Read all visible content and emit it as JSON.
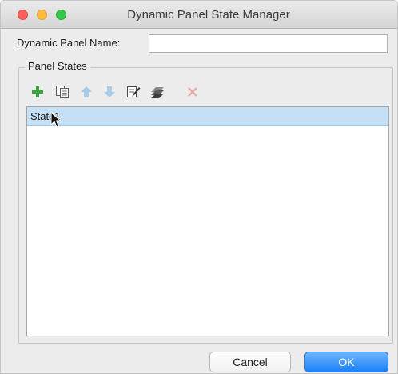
{
  "window": {
    "title": "Dynamic Panel State Manager"
  },
  "form": {
    "name_label": "Dynamic Panel Name:",
    "name_value": ""
  },
  "panel_states": {
    "legend": "Panel States",
    "toolbar": [
      {
        "name": "add-state-icon",
        "color": "#3aa53a",
        "enabled": true
      },
      {
        "name": "duplicate-state-icon",
        "color": "#6c6c6c",
        "enabled": true
      },
      {
        "name": "move-up-icon",
        "color": "#a9cbe8",
        "enabled": false
      },
      {
        "name": "move-down-icon",
        "color": "#a9cbe8",
        "enabled": false
      },
      {
        "name": "edit-state-icon",
        "color": "#4a4a4a",
        "enabled": true
      },
      {
        "name": "edit-all-states-icon",
        "color": "#4a4a4a",
        "enabled": true
      },
      {
        "name": "delete-state-icon",
        "color": "#e7a3a3",
        "enabled": false
      }
    ],
    "states": [
      {
        "label": "State1",
        "selected": true
      }
    ]
  },
  "buttons": {
    "cancel": "Cancel",
    "ok": "OK"
  },
  "colors": {
    "selection": "#c5dff4",
    "ok_button": "#1a82fb"
  }
}
